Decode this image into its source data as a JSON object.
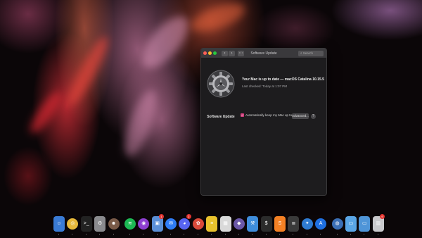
{
  "window": {
    "title": "Software Update",
    "search_placeholder": "Search",
    "pane_label": "Software Update",
    "status": "Your Mac is up to date — macOS Catalina 10.15.5",
    "last_checked": "Last checked: Today at 1:07 PM",
    "auto_update_label": "Automatically keep my Mac up to date",
    "auto_update_checked": true,
    "advanced_button": "Advanced...",
    "help_button": "?",
    "back_glyph": "‹",
    "forward_glyph": "›",
    "grid_glyph": "⋯"
  },
  "accent_color": "#d23f7d",
  "dock": {
    "items": [
      {
        "name": "finder-icon",
        "color": "#3a7bd5",
        "glyph": "☺"
      },
      {
        "name": "chrome-icon",
        "color": "#e8b93b",
        "glyph": "◎",
        "round": true
      },
      {
        "name": "terminal-icon",
        "color": "#222222",
        "glyph": ">_"
      },
      {
        "name": "system-preferences-icon",
        "color": "#8a8a8e",
        "glyph": "⚙"
      },
      {
        "name": "avatar-app-icon",
        "color": "#7a5a48",
        "glyph": "☻",
        "round": true
      },
      {
        "name": "spotify-icon",
        "color": "#1db954",
        "glyph": "≋",
        "round": true
      },
      {
        "name": "podcasts-icon",
        "color": "#8e3fd1",
        "glyph": "◉",
        "round": true
      },
      {
        "name": "preview-icon",
        "color": "#5b8fd6",
        "glyph": "▣",
        "badge": "1"
      },
      {
        "name": "messenger-icon",
        "color": "#2f7cf6",
        "glyph": "✉",
        "round": true
      },
      {
        "name": "discord-icon",
        "color": "#5865f2",
        "glyph": "◕",
        "round": true,
        "badge": "2"
      },
      {
        "name": "photos-icon",
        "color": "#d94a3a",
        "glyph": "✿",
        "round": true
      },
      {
        "name": "notes-icon",
        "color": "#e9c22d",
        "glyph": "≡"
      },
      {
        "name": "calendar-icon",
        "color": "#d9d9d9",
        "glyph": "▦"
      },
      {
        "name": "sketch-icon",
        "color": "#6b58a8",
        "glyph": "◆",
        "round": true
      },
      {
        "name": "xcode-icon",
        "color": "#3f8ddb",
        "glyph": "⚒"
      },
      {
        "name": "activity-monitor-icon",
        "color": "#2b2b2b",
        "glyph": "$"
      },
      {
        "name": "sublime-icon",
        "color": "#f48024",
        "glyph": "S"
      },
      {
        "name": "stats-icon",
        "color": "#3a3a3a",
        "glyph": "≣"
      },
      {
        "name": "safari-icon",
        "color": "#2f7bd1",
        "glyph": "✦",
        "round": true
      },
      {
        "name": "app-store-icon",
        "color": "#1e6fe0",
        "glyph": "A",
        "round": true
      },
      {
        "name": "telescope-icon",
        "color": "#3b6fb5",
        "glyph": "◍",
        "round": true
      },
      {
        "name": "folder-icon",
        "color": "#5aa6e6",
        "glyph": "▭"
      },
      {
        "name": "downloads-folder-icon",
        "color": "#4f95d8",
        "glyph": "▭"
      },
      {
        "name": "trash-icon",
        "color": "#c9c9cc",
        "glyph": "▥",
        "badge": "9"
      }
    ]
  }
}
